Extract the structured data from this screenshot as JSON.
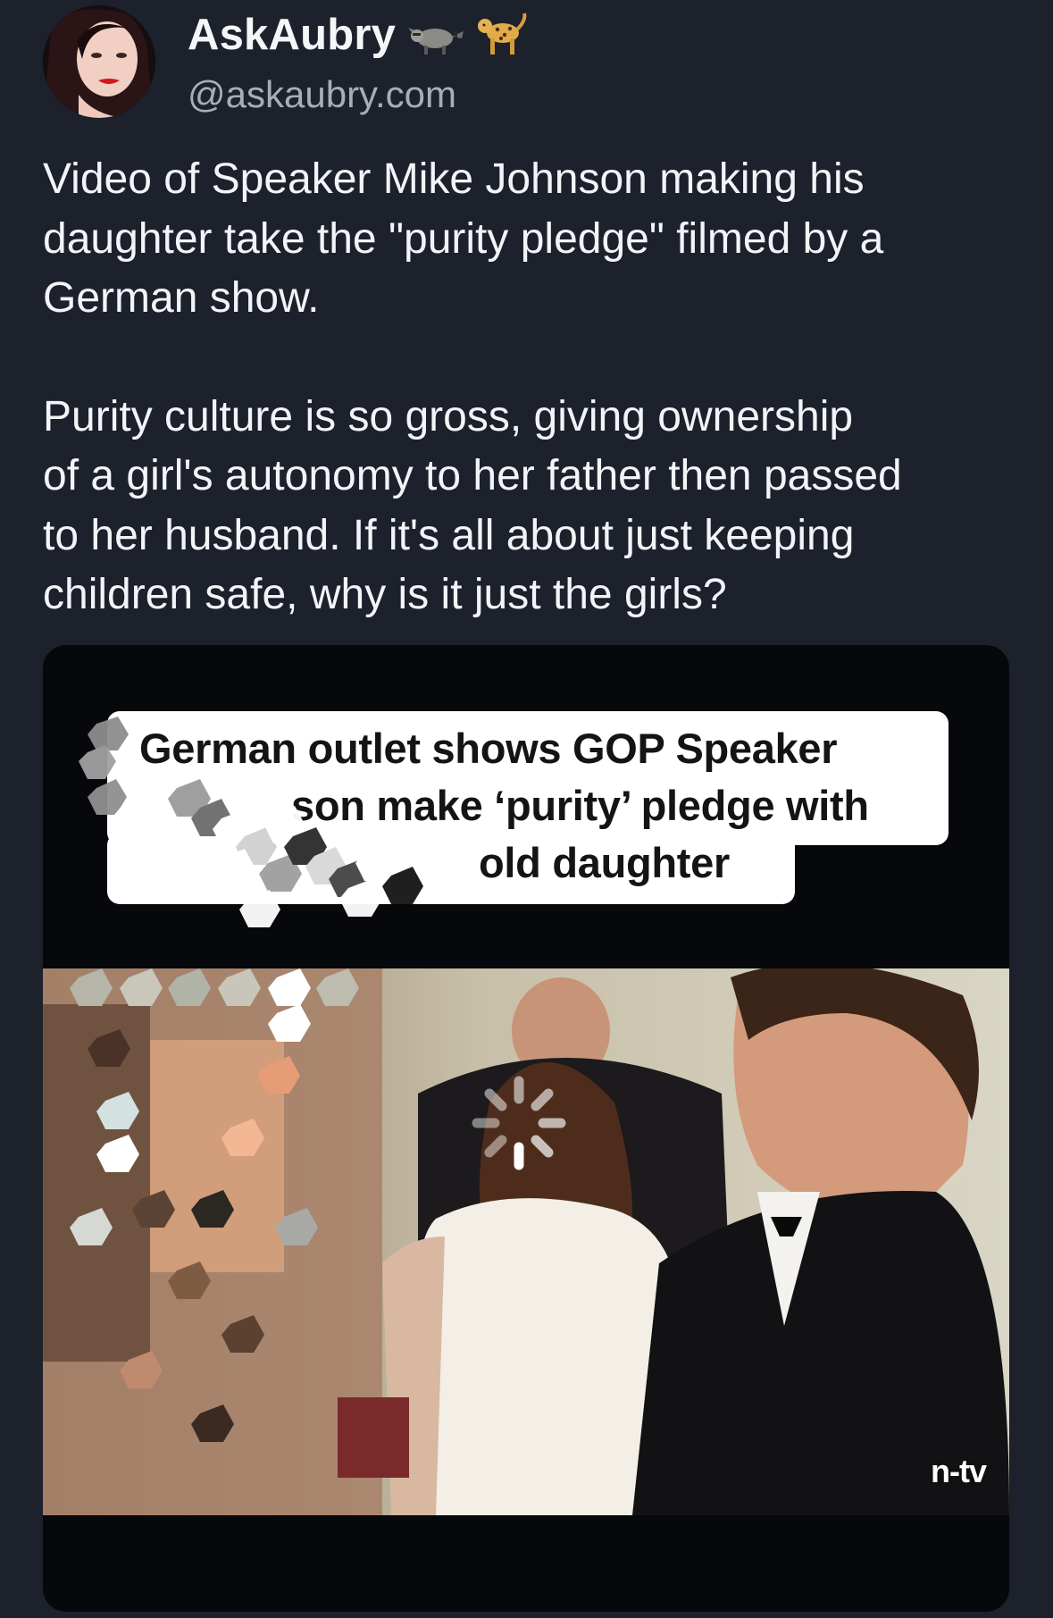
{
  "post": {
    "author": {
      "display_name": "AskAubry",
      "handle": "@askaubry.com",
      "badges": [
        "raccoon-icon",
        "leopard-icon"
      ]
    },
    "text_paragraphs": [
      "Video of Speaker Mike Johnson making his\ndaughter take the \"purity pledge\" filmed by a\nGerman show.",
      "Purity culture is so gross, giving ownership\nof a girl's autonomy to her father then passed\nto her husband. If it's all about just keeping\nchildren safe, why is it just the girls?"
    ],
    "media": {
      "caption_lines": [
        "German outlet shows GOP Speaker",
        "son make ‘purity’ pledge with",
        "old daughter"
      ],
      "watermark": "n-tv",
      "state": "loading"
    }
  },
  "colors": {
    "background": "#1c212b",
    "text_primary": "#f2f4f7",
    "text_secondary": "#a6aeba",
    "media_bg": "#07080b"
  }
}
